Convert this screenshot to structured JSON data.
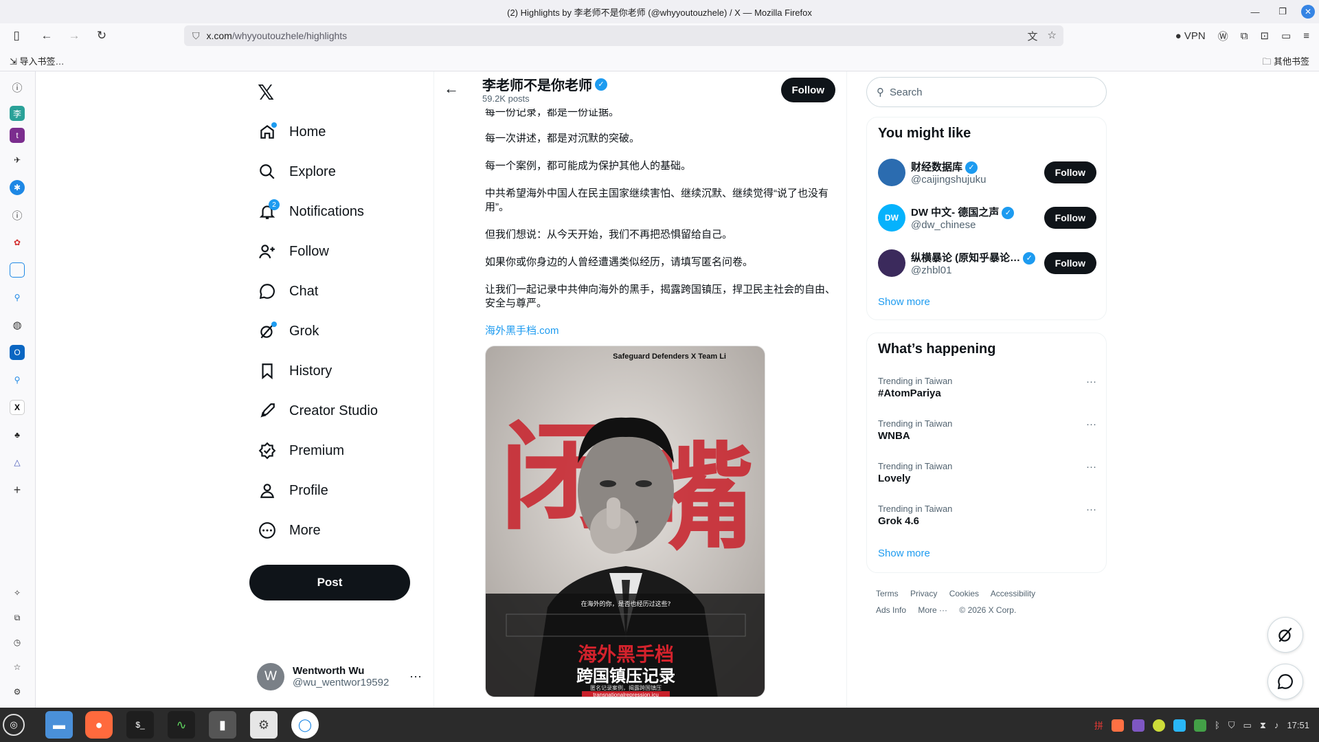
{
  "window": {
    "title": "(2) Highlights by 李老师不是你老师 (@whyyoutouzhele) / X — Mozilla Firefox"
  },
  "browser": {
    "url_host": "x.com",
    "url_path": "/whyyoutouzhele/highlights",
    "vpn_label": "VPN",
    "bookmark_left": "导入书签…",
    "bookmark_right": "其他书签"
  },
  "nav": {
    "items": [
      {
        "label": "Home",
        "icon": "home-icon"
      },
      {
        "label": "Explore",
        "icon": "search-icon"
      },
      {
        "label": "Notifications",
        "icon": "bell-icon",
        "badge": "2"
      },
      {
        "label": "Follow",
        "icon": "person-add-icon"
      },
      {
        "label": "Chat",
        "icon": "chat-icon"
      },
      {
        "label": "Grok",
        "icon": "grok-icon"
      },
      {
        "label": "History",
        "icon": "bookmark-icon"
      },
      {
        "label": "Creator Studio",
        "icon": "rocket-icon"
      },
      {
        "label": "Premium",
        "icon": "premium-icon"
      },
      {
        "label": "Profile",
        "icon": "person-icon"
      },
      {
        "label": "More",
        "icon": "more-circle-icon"
      }
    ],
    "post_label": "Post",
    "account": {
      "initial": "W",
      "name": "Wentworth Wu",
      "handle": "@wu_wentwor19592"
    }
  },
  "profile_header": {
    "name": "李老师不是你老师",
    "posts": "59.2K posts",
    "follow_label": "Follow"
  },
  "post": {
    "lines": [
      "每一份记录，都是一份证据。",
      "每一次讲述，都是对沉默的突破。",
      "每一个案例，都可能成为保护其他人的基础。",
      "中共希望海外中国人在民主国家继续害怕、继续沉默、继续觉得“说了也没有用”。",
      "但我们想说：从今天开始，我们不再把恐惧留给自己。",
      "如果你或你身边的人曾经遭遇类似经历，请填写匿名问卷。",
      "让我们一起记录中共伸向海外的黑手，揭露跨国镇压，捍卫民主社会的自由、安全与尊严。"
    ],
    "link": "海外黑手档.com",
    "image": {
      "top_credit": "Safeguard Defenders X Team Li",
      "big_chars": [
        "闭",
        "嘴"
      ],
      "question": "在海外的你，是否也经历过这些?",
      "headline_1": "海外黑手档",
      "headline_2": "跨国镇压记录",
      "sub": "匿名记录案例，揭露跨国镇压",
      "url": "transnationalrepression.icu"
    }
  },
  "search": {
    "placeholder": "Search"
  },
  "you_might_like": {
    "title": "You might like",
    "items": [
      {
        "name": "财经数据库",
        "handle": "@caijingshujuku",
        "follow": "Follow",
        "color": "#2b6cb0"
      },
      {
        "name": "DW 中文- 德国之声",
        "handle": "@dw_chinese",
        "follow": "Follow",
        "color": "#05b2fc"
      },
      {
        "name": "纵横暴论 (原知乎暴论…",
        "handle": "@zhbl01",
        "follow": "Follow",
        "color": "#3b2a5c"
      }
    ],
    "show_more": "Show more"
  },
  "whats_happening": {
    "title": "What’s happening",
    "items": [
      {
        "context": "Trending in Taiwan",
        "topic": "#AtomPariya"
      },
      {
        "context": "Trending in Taiwan",
        "topic": "WNBA"
      },
      {
        "context": "Trending in Taiwan",
        "topic": "Lovely"
      },
      {
        "context": "Trending in Taiwan",
        "topic": "Grok 4.6"
      }
    ],
    "show_more": "Show more"
  },
  "footer": {
    "links": [
      "Terms",
      "Privacy",
      "Cookies",
      "Accessibility",
      "Ads Info",
      "More ···"
    ],
    "copyright": "© 2026 X Corp."
  },
  "taskbar": {
    "clock": "17:51"
  }
}
